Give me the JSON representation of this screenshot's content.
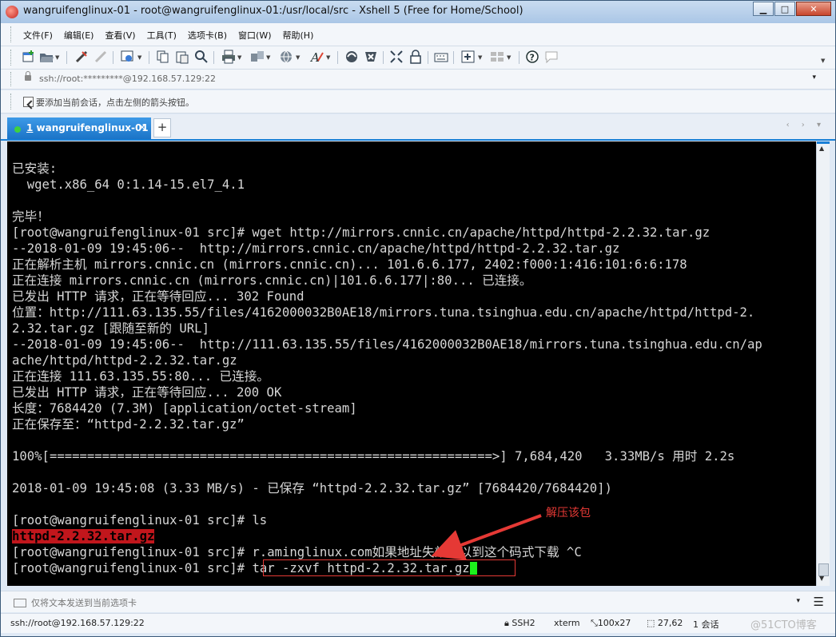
{
  "window": {
    "title": "wangruifenglinux-01 - root@wangruifenglinux-01:/usr/local/src - Xshell 5 (Free for Home/School)",
    "minimize": "▁",
    "maximize": "□",
    "close": "✕"
  },
  "menu": {
    "items": [
      "文件(F)",
      "编辑(E)",
      "查看(V)",
      "工具(T)",
      "选项卡(B)",
      "窗口(W)",
      "帮助(H)"
    ]
  },
  "address": {
    "text": "ssh://root:*********@192.168.57.129:22",
    "dropdown": "▾"
  },
  "hint": {
    "text": "要添加当前会话，点击左侧的箭头按钮。"
  },
  "tabs": {
    "active": {
      "number": "1",
      "label": " wangruifenglinux-01",
      "close": "×"
    },
    "add": "+",
    "nav": "‹ › ▾"
  },
  "terminal": {
    "lines": [
      "已安装:",
      "  wget.x86_64 0:1.14-15.el7_4.1",
      "",
      "完毕！",
      "[root@wangruifenglinux-01 src]# wget http://mirrors.cnnic.cn/apache/httpd/httpd-2.2.32.tar.gz",
      "--2018-01-09 19:45:06--  http://mirrors.cnnic.cn/apache/httpd/httpd-2.2.32.tar.gz",
      "正在解析主机 mirrors.cnnic.cn (mirrors.cnnic.cn)... 101.6.6.177, 2402:f000:1:416:101:6:6:178",
      "正在连接 mirrors.cnnic.cn (mirrors.cnnic.cn)|101.6.6.177|:80... 已连接。",
      "已发出 HTTP 请求，正在等待回应... 302 Found",
      "位置：http://111.63.135.55/files/4162000032B0AE18/mirrors.tuna.tsinghua.edu.cn/apache/httpd/httpd-2.",
      "2.32.tar.gz [跟随至新的 URL]",
      "--2018-01-09 19:45:06--  http://111.63.135.55/files/4162000032B0AE18/mirrors.tuna.tsinghua.edu.cn/ap",
      "ache/httpd/httpd-2.2.32.tar.gz",
      "正在连接 111.63.135.55:80... 已连接。",
      "已发出 HTTP 请求，正在等待回应... 200 OK",
      "长度：7684420 (7.3M) [application/octet-stream]",
      "正在保存至：“httpd-2.2.32.tar.gz”",
      "",
      "100%[===========================================================>] 7,684,420   3.33MB/s 用时 2.2s",
      "",
      "2018-01-09 19:45:08 (3.33 MB/s) - 已保存 “httpd-2.2.32.tar.gz” [7684420/7684420])",
      "",
      "[root@wangruifenglinux-01 src]# ls"
    ],
    "ls_output": "httpd-2.2.32.tar.gz",
    "line_after": "[root@wangruifenglinux-01 src]# r.aminglinux.com如果地址失效可以到这个码式下载 ^C",
    "prompt": "[root@wangruifenglinux-01 src]# ",
    "current_command": "tar -zxvf httpd-2.2.32.tar.gz",
    "annotation": "解压该包",
    "annotation_color": "#e53935",
    "cursor_color": "#1cf21c"
  },
  "compose": {
    "placeholder": "仅将文本发送到当前选项卡",
    "dropdown": "▾",
    "menu": "☰"
  },
  "status": {
    "connection": "ssh://root@192.168.57.129:22",
    "protocol": "SSH2",
    "terminal_type": "xterm",
    "size": "100x27",
    "cursor_pos": "27,62",
    "sessions": "1 会话",
    "watermark": "@51CTO博客"
  }
}
